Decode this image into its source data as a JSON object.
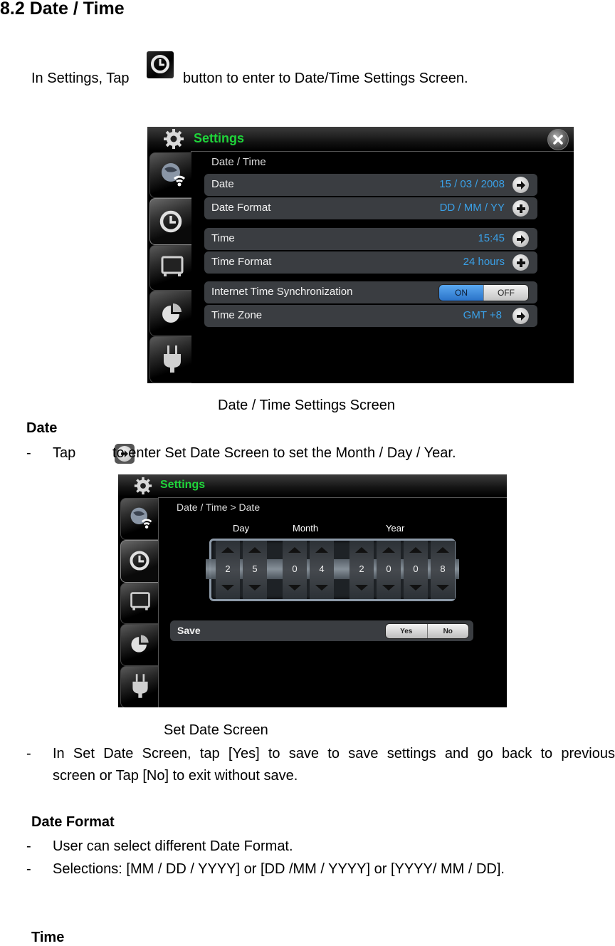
{
  "heading": "8.2 Date / Time",
  "intro": {
    "before": "In Settings, Tap",
    "icon": "clock-icon",
    "after": "button to enter to Date/Time Settings Screen."
  },
  "screen1": {
    "app_title": "Settings",
    "close_icon": "close-icon",
    "sidebar": [
      {
        "icon": "globe-wifi-icon",
        "active": false
      },
      {
        "icon": "clock-icon",
        "active": true
      },
      {
        "icon": "display-icon",
        "active": false
      },
      {
        "icon": "pie-chart-icon",
        "active": false
      },
      {
        "icon": "power-plug-icon",
        "active": false
      }
    ],
    "section_title": "Date / Time",
    "rows": [
      {
        "label": "Date",
        "value": "15 / 03 / 2008",
        "action": "arrow-right-icon"
      },
      {
        "label": "Date Format",
        "value": "DD / MM / YY",
        "action": "plus-icon"
      },
      {
        "label": "Time",
        "value": "15:45",
        "action": "arrow-right-icon"
      },
      {
        "label": "Time Format",
        "value": "24 hours",
        "action": "plus-icon"
      },
      {
        "label": "Internet Time Synchronization",
        "toggle": {
          "on": "ON",
          "off": "OFF",
          "selected": "ON"
        }
      },
      {
        "label": "Time Zone",
        "value": "GMT +8",
        "action": "arrow-right-icon"
      }
    ],
    "accent_color": "#1fd43a",
    "value_color": "#3aa0e6"
  },
  "caption1": "Date / Time Settings Screen",
  "date_section": {
    "title": "Date",
    "bullet_dash": "-",
    "tap_before": "Tap",
    "tap_icon": "arrow-right-icon",
    "tap_after": "to enter Set Date Screen to set the Month / Day / Year."
  },
  "screen2": {
    "app_title": "Settings",
    "breadcrumb": "Date / Time > Date",
    "columns": {
      "day": "Day",
      "month": "Month",
      "year": "Year"
    },
    "digits": {
      "day": [
        "2",
        "5"
      ],
      "month": [
        "0",
        "4"
      ],
      "year": [
        "2",
        "0",
        "0",
        "8"
      ]
    },
    "save_label": "Save",
    "yes_label": "Yes",
    "no_label": "No"
  },
  "caption2": "Set Date Screen",
  "save_note": {
    "line1": "In Set Date Screen, tap [Yes] to save to save settings and go back to previous",
    "line2": "screen or Tap [No] to exit without save."
  },
  "date_format_section": {
    "title": "Date Format",
    "bullets": [
      "User can select different Date Format.",
      "Selections: [MM / DD / YYYY] or [DD /MM / YYYY] or [YYYY/ MM / DD]."
    ]
  },
  "time_section": {
    "title": "Time"
  }
}
